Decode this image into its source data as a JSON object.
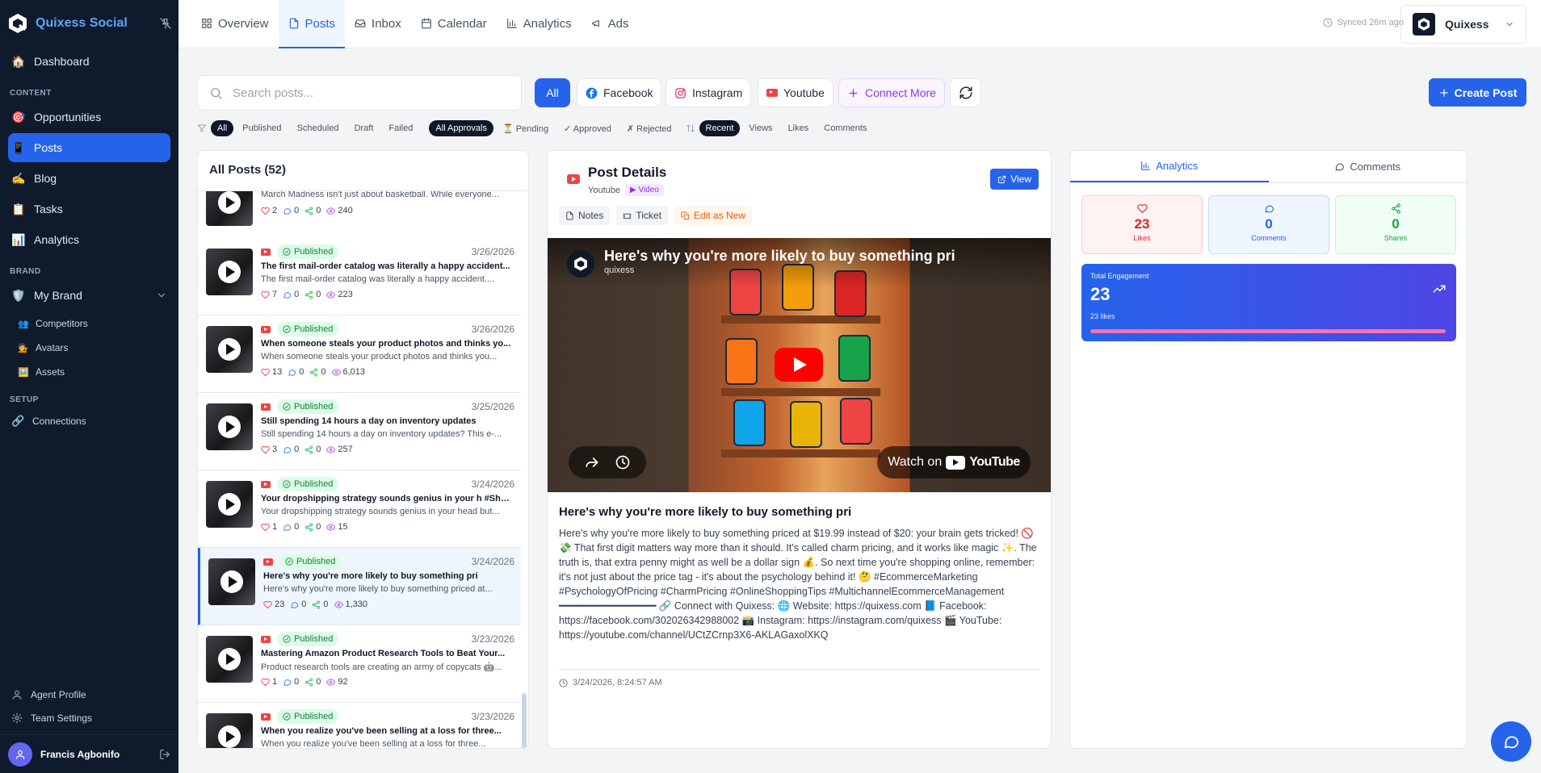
{
  "brand": {
    "name": "Quixess Social"
  },
  "sidebar": {
    "top_item": {
      "label": "Dashboard"
    },
    "content_label": "CONTENT",
    "content_items": [
      {
        "label": "Opportunities"
      },
      {
        "label": "Posts"
      },
      {
        "label": "Blog"
      },
      {
        "label": "Tasks"
      },
      {
        "label": "Analytics"
      }
    ],
    "brand_label": "BRAND",
    "brand_item": {
      "label": "My Brand"
    },
    "brand_sub": [
      {
        "label": "Competitors"
      },
      {
        "label": "Avatars"
      },
      {
        "label": "Assets"
      }
    ],
    "setup_label": "SETUP",
    "setup_item": {
      "label": "Connections"
    },
    "bottom": [
      {
        "label": "Agent Profile"
      },
      {
        "label": "Team Settings"
      }
    ],
    "user": {
      "name": "Francis Agbonifo"
    }
  },
  "topbar": {
    "tabs": [
      {
        "label": "Overview"
      },
      {
        "label": "Posts"
      },
      {
        "label": "Inbox"
      },
      {
        "label": "Calendar"
      },
      {
        "label": "Analytics"
      },
      {
        "label": "Ads"
      }
    ],
    "synced": "Synced 26m ago",
    "account": "Quixess"
  },
  "toolbar": {
    "search_placeholder": "Search posts...",
    "platforms": {
      "all": "All",
      "facebook": "Facebook",
      "instagram": "Instagram",
      "youtube": "Youtube",
      "connect": "Connect More"
    },
    "create": "Create Post"
  },
  "filters": {
    "status": [
      "All",
      "Published",
      "Scheduled",
      "Draft",
      "Failed"
    ],
    "approvals": [
      "All Approvals",
      "⏳ Pending",
      "✓ Approved",
      "✗ Rejected"
    ],
    "sort": [
      "Recent",
      "Views",
      "Likes",
      "Comments"
    ]
  },
  "list": {
    "title": "All Posts (52)",
    "posts": [
      {
        "status": "",
        "date": "",
        "title": "March Madness isn't just about basketball. While",
        "desc": "March Madness isn't just about basketball. While everyone...",
        "likes": "2",
        "comments": "0",
        "shares": "0",
        "views": "240"
      },
      {
        "status": "Published",
        "date": "3/26/2026",
        "title": "The first mail-order catalog was literally a happy accident...",
        "desc": "The first mail-order catalog was literally a happy accident....",
        "likes": "7",
        "comments": "0",
        "shares": "0",
        "views": "223"
      },
      {
        "status": "Published",
        "date": "3/26/2026",
        "title": "When someone steals your product photos and thinks yo...",
        "desc": "When someone steals your product photos and thinks you...",
        "likes": "13",
        "comments": "0",
        "shares": "0",
        "views": "6,013"
      },
      {
        "status": "Published",
        "date": "3/25/2026",
        "title": "Still spending 14 hours a day on inventory updates",
        "desc": "Still spending 14 hours a day on inventory updates? This e-...",
        "likes": "3",
        "comments": "0",
        "shares": "0",
        "views": "257"
      },
      {
        "status": "Published",
        "date": "3/24/2026",
        "title": "Your dropshipping strategy sounds genius in your h #Shorts",
        "desc": "Your dropshipping strategy sounds genius in your head but...",
        "likes": "1",
        "comments": "0",
        "shares": "0",
        "views": "15"
      },
      {
        "status": "Published",
        "date": "3/24/2026",
        "title": "Here's why you're more likely to buy something pri",
        "desc": "Here's why you're more likely to buy something priced at...",
        "likes": "23",
        "comments": "0",
        "shares": "0",
        "views": "1,330"
      },
      {
        "status": "Published",
        "date": "3/23/2026",
        "title": "Mastering Amazon Product Research Tools to Beat Your...",
        "desc": "Product research tools are creating an army of copycats 🤖...",
        "likes": "1",
        "comments": "0",
        "shares": "0",
        "views": "92"
      },
      {
        "status": "Published",
        "date": "3/23/2026",
        "title": "When you realize you've been selling at a loss for three...",
        "desc": "When you realize you've been selling at a loss for three...",
        "likes": "",
        "comments": "",
        "shares": "",
        "views": ""
      }
    ]
  },
  "details": {
    "header": "Post Details",
    "platform": "Youtube",
    "type": "Video",
    "view": "View",
    "actions": {
      "notes": "Notes",
      "ticket": "Ticket",
      "edit": "Edit as New"
    },
    "video": {
      "title": "Here's why you're more likely to buy something pri",
      "channel": "quixess",
      "watch_on": "Watch on",
      "yt_word": "YouTube"
    },
    "title": "Here's why you're more likely to buy something pri",
    "body": "Here's why you're more likely to buy something priced at $19.99 instead of $20: your brain gets tricked! 🚫💸 That first digit matters way more than it should. It's called charm pricing, and it works like magic ✨. The truth is, that extra penny might as well be a dollar sign 💰. So next time you're shopping online, remember: it's not just about the price tag - it's about the psychology behind it! 🤔 #EcommerceMarketing #PsychologyOfPricing #CharmPricing #OnlineShoppingTips #MultichannelEcommerceManagement ━━━━━━━━━━━━━━━━ 🔗 Connect with Quixess: 🌐 Website: https://quixess.com 📘 Facebook: https://facebook.com/302026342988002 📸 Instagram: https://instagram.com/quixess 🎬 YouTube: https://youtube.com/channel/UCtZCrnp3X6-AKLAGaxolXKQ",
    "datetime": "3/24/2026, 8:24:57 AM"
  },
  "analytics": {
    "tabs": {
      "analytics": "Analytics",
      "comments": "Comments"
    },
    "likes": {
      "value": "23",
      "label": "Likes"
    },
    "comments": {
      "value": "0",
      "label": "Comments"
    },
    "shares": {
      "value": "0",
      "label": "Shares"
    },
    "total": {
      "label": "Total Engagement",
      "value": "23",
      "sub": "23 likes",
      "likes_fraction": 1.0
    }
  },
  "colors": {
    "accent": "#2563eb",
    "sidebar": "#0f1b2d",
    "published": "#15803d",
    "youtube": "#ef4444"
  }
}
